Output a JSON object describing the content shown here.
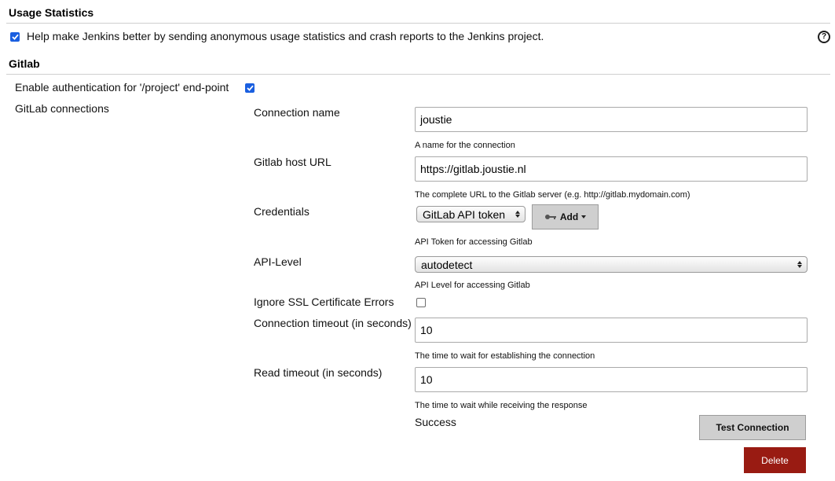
{
  "usage": {
    "title": "Usage Statistics",
    "checkbox_label": "Help make Jenkins better by sending anonymous usage statistics and crash reports to the Jenkins project.",
    "checked": true,
    "help_glyph": "?"
  },
  "gitlab": {
    "title": "Gitlab",
    "auth_label": "Enable authentication for '/project' end-point",
    "auth_checked": true,
    "connections_label": "GitLab connections",
    "connection": {
      "name_label": "Connection name",
      "name_value": "joustie",
      "name_hint": "A name for the connection",
      "host_label": "Gitlab host URL",
      "host_value": "https://gitlab.joustie.nl",
      "host_hint": "The complete URL to the Gitlab server (e.g. http://gitlab.mydomain.com)",
      "credentials_label": "Credentials",
      "credentials_selected": "GitLab API token",
      "add_label": "Add",
      "credentials_hint": "API Token for accessing Gitlab",
      "api_level_label": "API-Level",
      "api_level_selected": "autodetect",
      "api_level_hint": "API Level for accessing Gitlab",
      "ignore_ssl_label": "Ignore SSL Certificate Errors",
      "ignore_ssl_checked": false,
      "conn_timeout_label": "Connection timeout (in seconds)",
      "conn_timeout_value": "10",
      "conn_timeout_hint": "The time to wait for establishing the connection",
      "read_timeout_label": "Read timeout (in seconds)",
      "read_timeout_value": "10",
      "read_timeout_hint": "The time to wait while receiving the response",
      "status_text": "Success",
      "test_button_label": "Test Connection",
      "delete_button_label": "Delete"
    }
  },
  "colors": {
    "checkbox_blue": "#1a5fe0",
    "delete_red": "#991b12",
    "button_gray": "#cfcfcf"
  },
  "icons": [
    "checkmark-icon",
    "help-icon",
    "key-icon",
    "caret-down-icon",
    "select-arrows-icon"
  ]
}
